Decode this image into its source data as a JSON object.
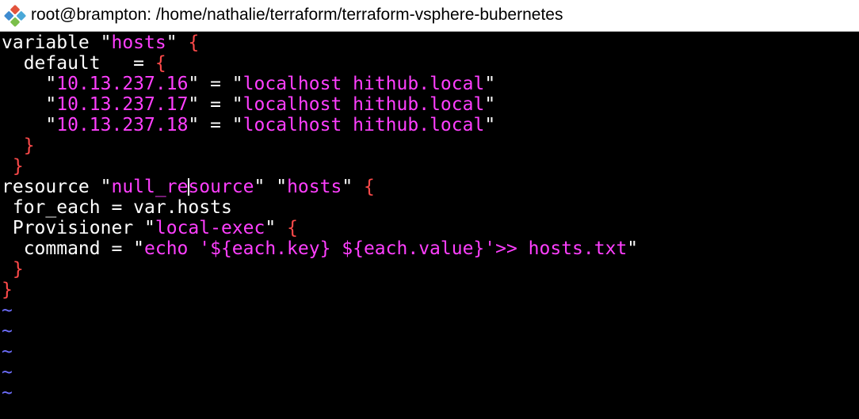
{
  "window": {
    "title": "root@brampton: /home/nathalie/terraform/terraform-vsphere-bubernetes",
    "icon": "git-bash-icon"
  },
  "colors": {
    "background": "#000000",
    "text": "#ffffff",
    "string": "#ff3fff",
    "brace": "#ff4a4a",
    "tilde": "#6f6fff"
  },
  "editor": {
    "lines": [
      [
        {
          "t": "variable \"",
          "c": "text"
        },
        {
          "t": "hosts",
          "c": "string"
        },
        {
          "t": "\" ",
          "c": "text"
        },
        {
          "t": "{",
          "c": "brace"
        }
      ],
      [
        {
          "t": "  default   = ",
          "c": "text"
        },
        {
          "t": "{",
          "c": "brace"
        }
      ],
      [
        {
          "t": "    \"",
          "c": "text"
        },
        {
          "t": "10.13.237.16",
          "c": "string"
        },
        {
          "t": "\" = \"",
          "c": "text"
        },
        {
          "t": "localhost hithub.local",
          "c": "string"
        },
        {
          "t": "\"",
          "c": "text"
        }
      ],
      [
        {
          "t": "    \"",
          "c": "text"
        },
        {
          "t": "10.13.237.17",
          "c": "string"
        },
        {
          "t": "\" = \"",
          "c": "text"
        },
        {
          "t": "localhost hithub.local",
          "c": "string"
        },
        {
          "t": "\"",
          "c": "text"
        }
      ],
      [
        {
          "t": "    \"",
          "c": "text"
        },
        {
          "t": "10.13.237.18",
          "c": "string"
        },
        {
          "t": "\" = \"",
          "c": "text"
        },
        {
          "t": "localhost hithub.local",
          "c": "string"
        },
        {
          "t": "\"",
          "c": "text"
        }
      ],
      [
        {
          "t": "  }",
          "c": "brace"
        }
      ],
      [
        {
          "t": " }",
          "c": "brace"
        }
      ],
      [
        {
          "t": "resource \"",
          "c": "text"
        },
        {
          "t": "null_re",
          "c": "string"
        },
        {
          "t": "",
          "c": "cursor"
        },
        {
          "t": "source",
          "c": "string"
        },
        {
          "t": "\" \"",
          "c": "text"
        },
        {
          "t": "hosts",
          "c": "string"
        },
        {
          "t": "\" ",
          "c": "text"
        },
        {
          "t": "{",
          "c": "brace"
        }
      ],
      [
        {
          "t": " for_each = var.hosts",
          "c": "text"
        }
      ],
      [
        {
          "t": " Provisioner \"",
          "c": "text"
        },
        {
          "t": "local-exec",
          "c": "string"
        },
        {
          "t": "\" ",
          "c": "text"
        },
        {
          "t": "{",
          "c": "brace"
        }
      ],
      [
        {
          "t": "  command = \"",
          "c": "text"
        },
        {
          "t": "echo '${each.key} ${each.value}'>> hosts.txt",
          "c": "string"
        },
        {
          "t": "\"",
          "c": "text"
        }
      ],
      [
        {
          "t": " }",
          "c": "brace"
        }
      ],
      [
        {
          "t": "}",
          "c": "brace"
        }
      ],
      [
        {
          "t": "~",
          "c": "tilde"
        }
      ],
      [
        {
          "t": "~",
          "c": "tilde"
        }
      ],
      [
        {
          "t": "~",
          "c": "tilde"
        }
      ],
      [
        {
          "t": "~",
          "c": "tilde"
        }
      ],
      [
        {
          "t": "~",
          "c": "tilde"
        }
      ]
    ]
  }
}
